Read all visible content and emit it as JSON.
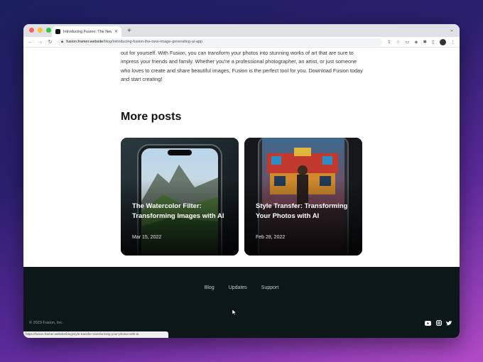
{
  "browser": {
    "tab_title": "Introducing Fusion: The New I",
    "url_domain": "fusion.framer.website",
    "url_path": "/blog/introducing-fusion-the-new-image-generating-ai-app",
    "status_url": "https://fusion.framer.website/blog/style-transfer-transforming-your-photos-with-ai"
  },
  "article": {
    "intro_text": "out for yourself. With Fusion, you can transform your photos into stunning works of art that are sure to impress your friends and family. Whether you're a professional photographer, an artist, or just someone who loves to create and share beautiful images, Fusion is the perfect tool for you. Download Fusion today and start creating!"
  },
  "more_posts": {
    "heading": "More posts",
    "posts": [
      {
        "title": "The Watercolor Filter: Transforming Images with AI",
        "date": "Mar 15, 2022"
      },
      {
        "title": "Style Transfer: Transforming Your Photos with AI",
        "date": "Feb 28, 2022"
      }
    ]
  },
  "footer": {
    "links": [
      "Blog",
      "Updates",
      "Support"
    ],
    "copyright": "© 2023 Fusion, Inc.",
    "social_icons": [
      "youtube-icon",
      "instagram-icon",
      "twitter-icon"
    ]
  }
}
